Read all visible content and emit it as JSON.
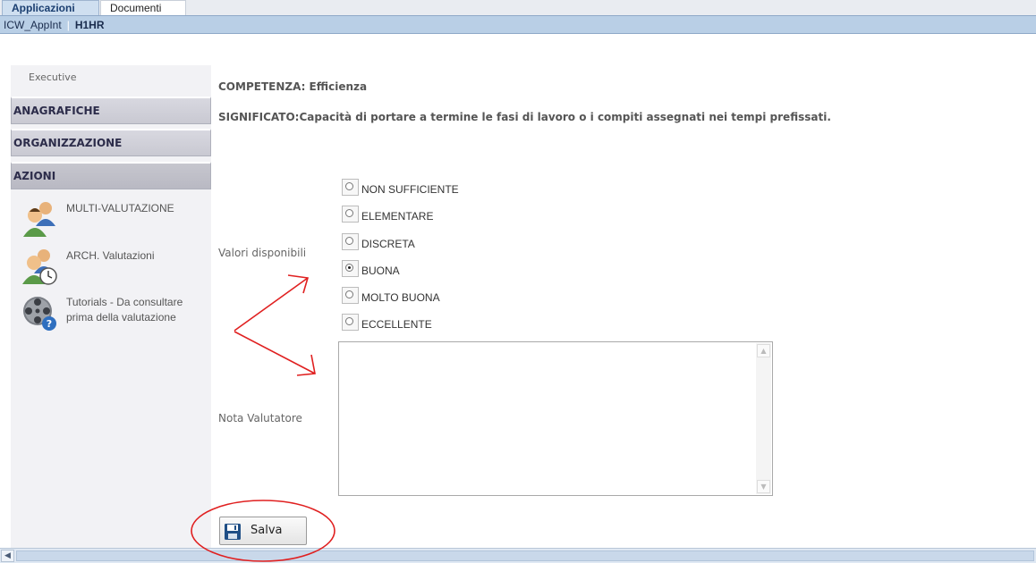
{
  "tabs": [
    {
      "label": "Applicazioni",
      "active": true
    },
    {
      "label": "Documenti",
      "active": false
    }
  ],
  "breadcrumb": {
    "app": "ICW_AppInt",
    "separator": "|",
    "module": "H1HR"
  },
  "sidebar": {
    "title": "Executive",
    "sections": [
      "ANAGRAFICHE",
      "ORGANIZZAZIONE",
      "AZIONI"
    ],
    "items": [
      {
        "label": "MULTI-VALUTAZIONE",
        "icon": "users-icon"
      },
      {
        "label": "ARCH. Valutazioni",
        "icon": "users-clock-icon"
      },
      {
        "label": "Tutorials - Da consultare prima della valutazione",
        "icon": "film-reel-help-icon"
      }
    ]
  },
  "main": {
    "competenza": "COMPETENZA: Efficienza",
    "significato": "SIGNIFICATO:Capacità di portare a termine le fasi di lavoro o i compiti assegnati nei tempi prefissati.",
    "valori_label": "Valori disponibili",
    "options": [
      "NON SUFFICIENTE",
      "ELEMENTARE",
      "DISCRETA",
      "BUONA",
      "MOLTO BUONA",
      "ECCELLENTE"
    ],
    "selected": "BUONA",
    "nota_label": "Nota Valutatore",
    "nota_value": "",
    "save_label": "Salva"
  },
  "colors": {
    "annotation": "#e02020",
    "accent": "#1a3e70"
  }
}
